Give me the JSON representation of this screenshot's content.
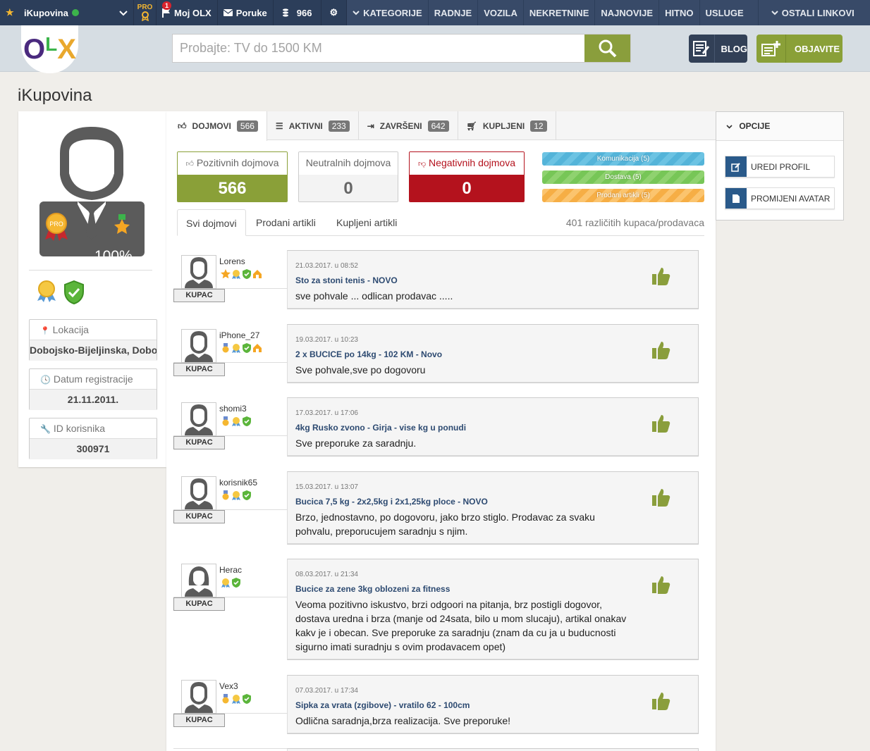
{
  "topbar": {
    "username": "iKupovina",
    "pro_label": "PRO",
    "notif_count": "1",
    "moj_olx": "Moj OLX",
    "poruke": "Poruke",
    "credits": "966",
    "nav": [
      "KATEGORIJE",
      "RADNJE",
      "VOZILA",
      "NEKRETNINE",
      "NAJNOVIJE",
      "HITNO",
      "USLUGE"
    ],
    "ostali": "OSTALI LINKOVI"
  },
  "header": {
    "logo": {
      "o": "O",
      "l": "L",
      "x": "X"
    },
    "search_placeholder": "Probajte: TV do 1500 KM",
    "blog": "BLOG",
    "objavite": "OBJAVITE"
  },
  "page_title": "iKupovina",
  "profile": {
    "percent": "100%",
    "pro_badge": "PRO",
    "lokacija_label": "Lokacija",
    "lokacija": "Dobojsko-Bijeljinska, Doboj",
    "datum_label": "Datum registracije",
    "datum": "21.11.2011.",
    "id_label": "ID korisnika",
    "id": "300971"
  },
  "tabs": [
    {
      "label": "DOJMOVI",
      "count": "566"
    },
    {
      "label": "AKTIVNI",
      "count": "233"
    },
    {
      "label": "ZAVRŠENI",
      "count": "642"
    },
    {
      "label": "KUPLJENI",
      "count": "12"
    }
  ],
  "stats": {
    "pos_label": "Pozitivnih dojmova",
    "pos": "566",
    "neu_label": "Neutralnih dojmova",
    "neu": "0",
    "neg_label": "Negativnih dojmova",
    "neg": "0"
  },
  "bars": [
    "Komunikacija (5)",
    "Dostava (5)",
    "Prodani artikli (5)"
  ],
  "subtabs": [
    "Svi dojmovi",
    "Prodani artikli",
    "Kupljeni artikli"
  ],
  "buyers_count": "401 različitih kupaca/prodavaca",
  "reviews": [
    {
      "user": "Lorens",
      "role": "KUPAC",
      "date": "21.03.2017. u 08:52",
      "title": "Sto za stoni tenis - NOVO",
      "text": "sve pohvale ... odlican prodavac .....",
      "icons": [
        "star",
        "ribbon",
        "shield",
        "house"
      ]
    },
    {
      "user": "iPhone_27",
      "role": "KUPAC",
      "date": "19.03.2017. u 10:23",
      "title": "2 x BUCICE po 14kg - 102 KM - Novo",
      "text": "Sve pohvale,sve po dogovoru",
      "icons": [
        "medal",
        "ribbon",
        "shield",
        "house"
      ]
    },
    {
      "user": "shomi3",
      "role": "KUPAC",
      "date": "17.03.2017. u 17:06",
      "title": "4kg Rusko zvono - Girja - vise kg u ponudi",
      "text": "Sve preporuke za saradnju.",
      "icons": [
        "medal",
        "ribbon",
        "shield"
      ]
    },
    {
      "user": "korisnik65",
      "role": "KUPAC",
      "date": "15.03.2017. u 13:07",
      "title": "Bucica 7,5 kg - 2x2,5kg i 2x1,25kg ploce - NOVO",
      "text": "Brzo, jednostavno, po dogovoru, jako brzo stiglo. Prodavac za svaku pohvalu, preporucujem saradnju s njim.",
      "icons": [
        "medal",
        "ribbon",
        "shield"
      ]
    },
    {
      "user": "Herac",
      "role": "KUPAC",
      "date": "08.03.2017. u 21:34",
      "title": "Bucice za zene 3kg oblozeni za fitness",
      "text": "Veoma pozitivno iskustvo, brzi odgoori na pitanja, brz postigli dogovor, dostava uredna i brza (manje od 24sata, bilo u mom slucaju), artikal onakav kakv je i obecan. Sve preporuke za saradnju (znam da cu ja u buducnosti sigurno imati suradnju s ovim prodavacem opet)",
      "icons": [
        "ribbon",
        "shield"
      ]
    },
    {
      "user": "Vex3",
      "role": "KUPAC",
      "date": "07.03.2017. u 17:34",
      "title": "Sipka za vrata (zgibove) - vratilo 62 - 100cm",
      "text": "Odlična saradnja,brza realizacija. Sve preporuke!",
      "icons": [
        "medal",
        "ribbon",
        "shield"
      ]
    }
  ],
  "options": {
    "title": "OPCIJE",
    "uredi": "UREDI PROFIL",
    "avatar": "PROMIJENI AVATAR"
  },
  "colors": {
    "navy": "#2c3e5a",
    "green": "#8aa038",
    "red": "#b4121d"
  }
}
